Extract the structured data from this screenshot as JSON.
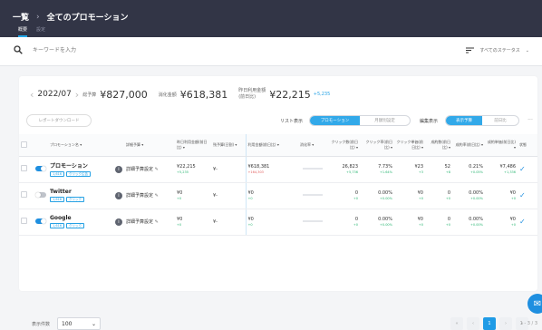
{
  "header": {
    "breadcrumb_root": "一覧",
    "breadcrumb_current": "全てのプロモーション",
    "tabs": [
      {
        "label": "概要",
        "active": true
      },
      {
        "label": "設定",
        "active": false
      }
    ]
  },
  "search": {
    "placeholder": "キーワードを入力",
    "filter_label": "すべてのステータス"
  },
  "summary": {
    "month": "2022/07",
    "budget_label": "総予算",
    "budget_value": "¥827,000",
    "spend_label": "消化金額",
    "spend_value": "¥618,381",
    "yesterday_label_line1": "昨日利用金額",
    "yesterday_label_line2": "(前日比)",
    "yesterday_value": "¥22,215",
    "yesterday_link": "+5,235"
  },
  "toolbar": {
    "report_button": "レポートダウンロード",
    "list_label": "リスト表示",
    "list_options": [
      {
        "label": "プロモーション",
        "active": true
      },
      {
        "label": "月額別設定",
        "active": false
      }
    ],
    "edit_label": "編集表示",
    "edit_options": [
      {
        "label": "表示予算",
        "active": true
      },
      {
        "label": "前日比",
        "active": false
      }
    ],
    "more": "..."
  },
  "table": {
    "headers": [
      "プロモーション名 ▾",
      "詳細予算 ▾",
      "昨日利用金額(前日比) ▾",
      "残予算(日割) ▾",
      "利用金額(前日比) ▾",
      "消化率 ▾",
      "クリック数(前日比) ▾",
      "クリック率(前日比) ▾",
      "クリック単価(前日比) ▾",
      "成約数(前日比) ▾",
      "成約率(前日比) ▾",
      "成約単価(前日比) ▾",
      "状態"
    ],
    "rows": [
      {
        "on": true,
        "name": "プロモーション",
        "tags": [
          "1,616",
          "クリック広告"
        ],
        "detail": "詳細予算設定",
        "yesterday": "¥22,215",
        "yesterday_sub": "+5,235",
        "remaining": "¥-",
        "spend": "¥618,381",
        "spend_sub": "+164,303",
        "spend_sub_red": true,
        "clicks": "26,823",
        "clicks_sub": "+5,736",
        "ctr": "7.73%",
        "ctr_sub": "+1.64%",
        "cpc": "¥23",
        "cpc_sub": "+3",
        "conv": "52",
        "conv_sub": "+8",
        "cvr": "0.21%",
        "cvr_sub": "+0.05%",
        "cpa": "¥7,486",
        "cpa_sub": "+1,336"
      },
      {
        "on": false,
        "name": "Twitter",
        "tags": [
          "1,616",
          "クリック"
        ],
        "detail": "詳細予算設定",
        "yesterday": "¥0",
        "yesterday_sub": "+0",
        "remaining": "¥-",
        "spend": "¥0",
        "spend_sub": "+0",
        "spend_sub_red": false,
        "clicks": "0",
        "clicks_sub": "+0",
        "ctr": "0.00%",
        "ctr_sub": "+0.00%",
        "cpc": "¥0",
        "cpc_sub": "+0",
        "conv": "0",
        "conv_sub": "+0",
        "cvr": "0.00%",
        "cvr_sub": "+0.00%",
        "cpa": "¥0",
        "cpa_sub": "+0"
      },
      {
        "on": true,
        "name": "Google",
        "tags": [
          "1,616",
          "クリック"
        ],
        "detail": "詳細予算設定",
        "yesterday": "¥0",
        "yesterday_sub": "+0",
        "remaining": "¥-",
        "spend": "¥0",
        "spend_sub": "+0",
        "spend_sub_red": false,
        "clicks": "0",
        "clicks_sub": "+0",
        "ctr": "0.00%",
        "ctr_sub": "+0.00%",
        "cpc": "¥0",
        "cpc_sub": "+0",
        "conv": "0",
        "conv_sub": "+0",
        "cvr": "0.00%",
        "cvr_sub": "+0.00%",
        "cpa": "¥0",
        "cpa_sub": "+0"
      }
    ]
  },
  "pagination": {
    "page_size_label": "表示件数",
    "page_size": "100",
    "pages": [
      "«",
      "‹",
      "1",
      "›",
      "»"
    ],
    "active_page": "1",
    "range": "1 - 3 / 3"
  },
  "colors": {
    "header_bg": "#323546",
    "accent": "#1f9be6"
  }
}
